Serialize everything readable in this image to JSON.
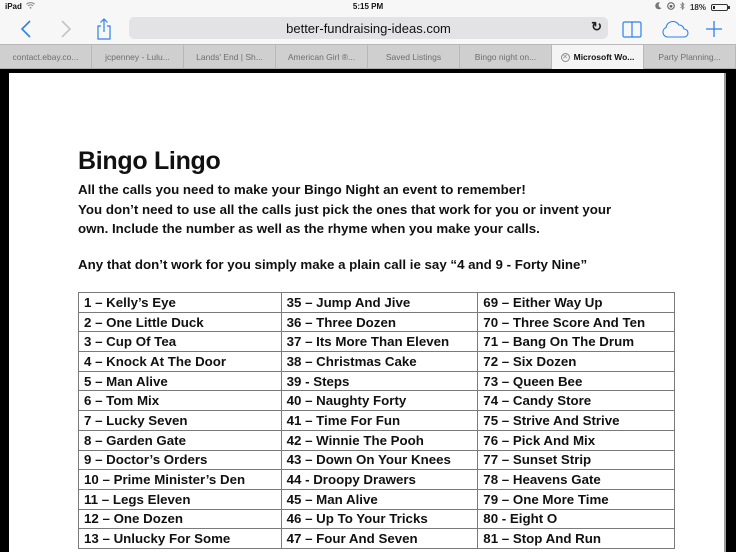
{
  "status_bar": {
    "device": "iPad",
    "time": "5:15 PM",
    "battery_percent_label": "18%",
    "battery_level": 0.18
  },
  "toolbar": {
    "url": "better-fundraising-ideas.com",
    "icons": [
      "back-icon",
      "forward-icon",
      "share-icon",
      "reload-icon",
      "bookmarks-icon",
      "icloud-tabs-icon",
      "new-tab-icon"
    ]
  },
  "tabs": [
    {
      "label": "contact.ebay.co...",
      "active": false
    },
    {
      "label": "jcpenney - Lulu...",
      "active": false
    },
    {
      "label": "Lands' End | Sh...",
      "active": false
    },
    {
      "label": "American Girl ®...",
      "active": false
    },
    {
      "label": "Saved Listings",
      "active": false
    },
    {
      "label": "Bingo night on...",
      "active": false
    },
    {
      "label": "Microsoft Wo...",
      "active": true
    },
    {
      "label": "Party Planning...",
      "active": false
    }
  ],
  "document": {
    "title": "Bingo Lingo",
    "intro_lines": [
      "All the calls you need to make your Bingo Night an event to remember!",
      "You don’t need to use all the calls just pick the ones that work for you or invent your",
      "own. Include the number as well as the rhyme when you make your calls."
    ],
    "note": "Any that don’t work for you simply make a plain call ie say  “4 and 9 - Forty Nine”",
    "table_rows": [
      [
        "1 – Kelly’s Eye",
        "35 – Jump And Jive",
        "69 – Either Way Up"
      ],
      [
        "2 – One Little Duck",
        "36 – Three Dozen",
        "70 – Three Score And Ten"
      ],
      [
        "3 – Cup Of Tea",
        "37 – Its More Than Eleven",
        "71 – Bang On The Drum"
      ],
      [
        "4 – Knock At The Door",
        "38 – Christmas Cake",
        "72 – Six Dozen"
      ],
      [
        "5 – Man Alive",
        "39 - Steps",
        "73 – Queen Bee"
      ],
      [
        "6 – Tom Mix",
        "40 – Naughty Forty",
        "74 – Candy Store"
      ],
      [
        "7 – Lucky Seven",
        "41 – Time For Fun",
        "75 – Strive And Strive"
      ],
      [
        "8 – Garden Gate",
        "42 – Winnie The Pooh",
        "76 – Pick  And Mix"
      ],
      [
        "9 – Doctor’s Orders",
        "43 – Down On Your Knees",
        "77 – Sunset Strip"
      ],
      [
        "10 – Prime Minister’s Den",
        "44 -  Droopy Drawers",
        "78 – Heavens Gate"
      ],
      [
        "11 – Legs Eleven",
        "45 – Man Alive",
        "79 – One More Time"
      ],
      [
        "12 – One Dozen",
        "46 – Up To Your Tricks",
        "80 - Eight O"
      ],
      [
        "13 – Unlucky For Some",
        "47 – Four And Seven",
        "81 – Stop And Run"
      ]
    ]
  },
  "colors": {
    "accent": "#2f80ed",
    "chrome_bg": "#f7f7f7",
    "tabbar_bg": "#cfcfcf"
  }
}
